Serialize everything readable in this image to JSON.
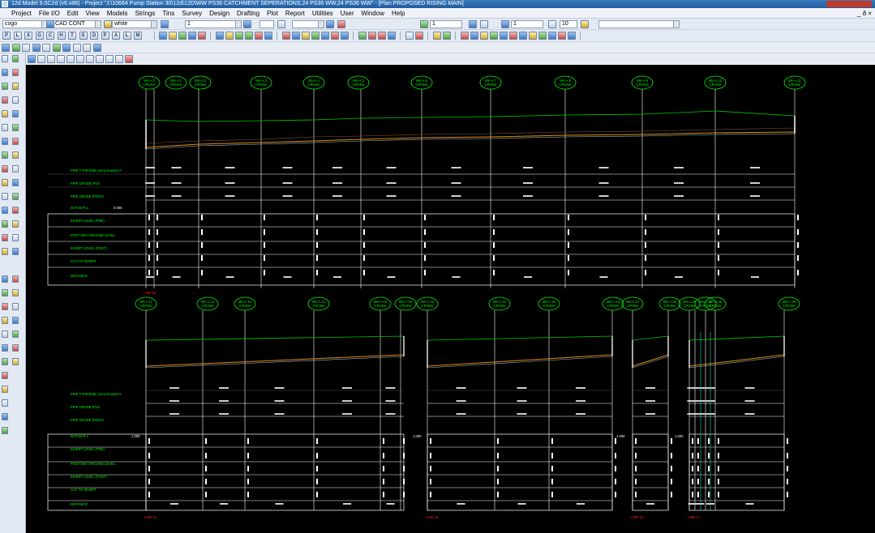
{
  "window": {
    "title": "12d Model 9.0C2d (v6.x86) - Project \"J:\\10664 Pump Station 30\\12d\\12D\\WW PS36 CATCHMENT SEPERATIONS,24 PS36 WW,24 PS36 WW\" - [Plan PROPOSED RISING MAIN]"
  },
  "menu": {
    "items": [
      {
        "label": "Project",
        "key": "menu-project"
      },
      {
        "label": "File I/O",
        "key": "menu-file-io"
      },
      {
        "label": "Edit",
        "key": "menu-edit"
      },
      {
        "label": "View",
        "key": "menu-view"
      },
      {
        "label": "Models",
        "key": "menu-models"
      },
      {
        "label": "Strings",
        "key": "menu-strings"
      },
      {
        "label": "Tins",
        "key": "menu-tins"
      },
      {
        "label": "Survey",
        "key": "menu-survey"
      },
      {
        "label": "Design",
        "key": "menu-design"
      },
      {
        "label": "Drafting",
        "key": "menu-drafting"
      },
      {
        "label": "Plot",
        "key": "menu-plot"
      },
      {
        "label": "Report",
        "key": "menu-report"
      },
      {
        "label": "Utilities",
        "key": "menu-utilities"
      },
      {
        "label": "User",
        "key": "menu-user"
      },
      {
        "label": "Window",
        "key": "menu-window"
      },
      {
        "label": "Help",
        "key": "menu-help"
      }
    ],
    "right_glyph": "_ ð ×"
  },
  "toolbar": {
    "model_combo": "cogo",
    "style_combo": "CAD CONT",
    "colour_combo": "white",
    "weight_value": "1",
    "field_1": "1",
    "field_2": "1",
    "field_3": "10",
    "letter_buttons": [
      "P",
      "L",
      "X",
      "G",
      "C",
      "H",
      "T",
      "S",
      "D",
      "P",
      "A",
      "L",
      "M"
    ]
  },
  "drawing": {
    "row_labels_top": [
      "PIPE TYPE/SIZE (mm) /Hazard #",
      "PIPE GRADE (Pre)",
      "PIPE GRADE (POST)",
      "DATUM R.L.",
      "INVERT LEVEL (PRE)",
      "POST DEV GROUND LEVEL",
      "INVERT LEVEL (POST)",
      "CUT TO INVERT",
      "DISTANCE"
    ],
    "row_labels_bottom": [
      "PIPE TYPE/SIZE (mm) /Hazard #",
      "PIPE GRADE (Pre)",
      "PIPE GRADE (POST)",
      "DATUM R.L.",
      "INVERT LEVEL (PRE)",
      "POST DEV GROUND LEVEL",
      "INVERT LEVEL (POST)",
      "CUT TO INVERT",
      "DISTANCE"
    ],
    "datum_value_top": "0.000",
    "datum_values_bottom": [
      "1.000",
      "1.000",
      "1.000",
      "1.000"
    ],
    "section_labels": [
      "LINE 10",
      "LINE 12",
      "LINE 15",
      "LINE 16",
      "LINE 17"
    ],
    "manholes_top": [
      {
        "name": "MH A.0",
        "sub": "CPONV"
      },
      {
        "name": "MH A.1",
        "sub": "CPONV"
      },
      {
        "name": "MH A.2",
        "sub": "CPONV"
      },
      {
        "name": "MH A.3",
        "sub": "CPONV"
      },
      {
        "name": "MH A.4",
        "sub": "CPONV"
      },
      {
        "name": "MH A.5",
        "sub": "CPONV"
      },
      {
        "name": "MH A.6",
        "sub": "CPONV"
      },
      {
        "name": "MH A.7",
        "sub": "CPONV"
      },
      {
        "name": "MH A.8",
        "sub": "CPONV"
      },
      {
        "name": "MH A.9",
        "sub": "CPONV"
      },
      {
        "name": "MH A.10",
        "sub": "CPONV"
      },
      {
        "name": "MH A.11",
        "sub": "CPONV"
      }
    ],
    "manholes_bottom": [
      {
        "name": "MH A.11",
        "sub": "CPONV"
      },
      {
        "name": "MH A.12",
        "sub": "CPONV"
      },
      {
        "name": "MH A.13",
        "sub": "CPONV"
      },
      {
        "name": "MH A.14",
        "sub": "CPONV"
      },
      {
        "name": "MH A.15",
        "sub": "CPONV"
      },
      {
        "name": "MH A.16",
        "sub": "CPONV"
      },
      {
        "name": "MH A.20",
        "sub": "CPONV"
      },
      {
        "name": "MH A.21",
        "sub": "CPONV"
      },
      {
        "name": "MH A.22",
        "sub": "CPONV"
      },
      {
        "name": "MH A.23",
        "sub": "CPONV"
      },
      {
        "name": "MH A.24",
        "sub": "CPONV"
      },
      {
        "name": "MH A.25",
        "sub": "CPONV"
      },
      {
        "name": "MH A.26",
        "sub": "CPONV"
      },
      {
        "name": "MH A.27",
        "sub": "CPONV"
      },
      {
        "name": "MH A.28",
        "sub": "CPONV"
      },
      {
        "name": "MH A.29",
        "sub": "CPONV"
      }
    ],
    "colors": {
      "background": "#000000",
      "label_green": "#00ff00",
      "grid_white": "#ffffff",
      "surface_green": "#00cc00",
      "pipe_orange": "#d98c1a",
      "section_red": "#ff2020"
    }
  }
}
